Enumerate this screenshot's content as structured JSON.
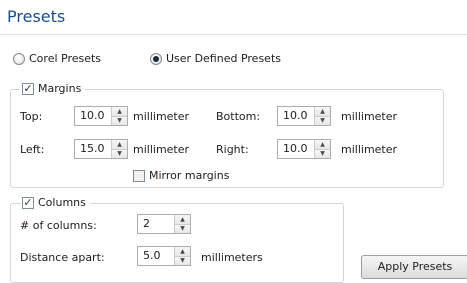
{
  "panel": {
    "title": "Presets"
  },
  "presets": {
    "options": [
      {
        "label": "Corel Presets",
        "selected": false
      },
      {
        "label": "User Defined Presets",
        "selected": true
      }
    ]
  },
  "margins": {
    "label": "Margins",
    "checked": true,
    "top": {
      "label": "Top:",
      "value": "10.0",
      "unit": "millimeter"
    },
    "bottom": {
      "label": "Bottom:",
      "value": "10.0",
      "unit": "millimeter"
    },
    "left": {
      "label": "Left:",
      "value": "15.0",
      "unit": "millimeter"
    },
    "right": {
      "label": "Right:",
      "value": "10.0",
      "unit": "millimeter"
    },
    "mirror": {
      "label": "Mirror margins",
      "checked": false
    }
  },
  "columns": {
    "label": "Columns",
    "checked": true,
    "count": {
      "label": "# of columns:",
      "value": "2"
    },
    "distance": {
      "label": "Distance apart:",
      "value": "5.0",
      "unit": "millimeters"
    }
  },
  "actions": {
    "apply_label": "Apply Presets"
  },
  "colors": {
    "title": "#1e4d8c",
    "group_border": "#d3d7dc"
  }
}
